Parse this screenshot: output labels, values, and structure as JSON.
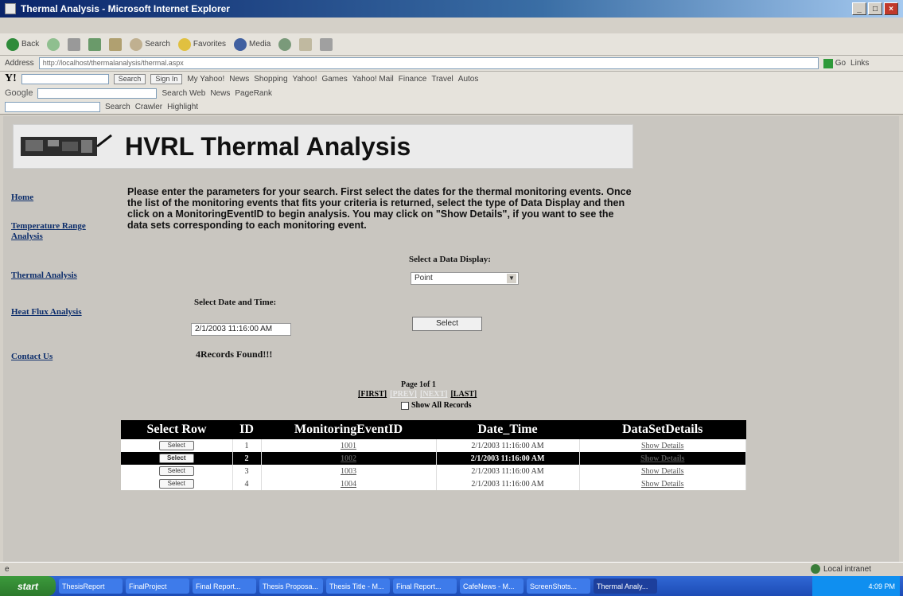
{
  "window": {
    "title": "Thermal Analysis - Microsoft Internet Explorer",
    "controls": [
      "_",
      "□",
      "×"
    ]
  },
  "toolbar": {
    "back": "Back",
    "search": "Search",
    "favorites": "Favorites",
    "media": "Media"
  },
  "address": {
    "label": "Address",
    "url": "http://localhost/thermalanalysis/thermal.aspx",
    "go": "Go",
    "links": "Links"
  },
  "yahoo_bar": {
    "logo": "Y!",
    "search_btn": "Search",
    "signin_btn": "Sign In",
    "items": [
      "My Yahoo!",
      "News",
      "Shopping",
      "Yahoo!",
      "Games",
      "Yahoo! Mail",
      "Finance",
      "Travel",
      "Autos"
    ]
  },
  "google_bar": {
    "logo": "Google",
    "search_web": "Search Web",
    "news": "News",
    "pagerank": "PageRank"
  },
  "search_bar": {
    "search": "Search",
    "crawler": "Crawler",
    "highlight": "Highlight"
  },
  "page": {
    "title": "HVRL Thermal Analysis",
    "nav": [
      {
        "label": "Home"
      },
      {
        "label": "Temperature Range Analysis"
      },
      {
        "label": "Thermal Analysis"
      },
      {
        "label": "Heat Flux Analysis"
      },
      {
        "label": "Contact Us"
      }
    ],
    "instructions": "Please enter the parameters for your search. First select the dates for the thermal monitoring events. Once the list of the monitoring events that fits your criteria is returned, select the type of Data Display and then click on a MonitoringEventID to begin analysis. You may click on \"Show Details\", if you want to see the data sets corresponding to each monitoring event.",
    "data_display_label": "Select a Data Display:",
    "data_display_value": "Point",
    "date_label": "Select Date and Time:",
    "date_value": "2/1/2003 11:16:00 AM",
    "select_button": "Select",
    "records_found": "4Records Found!!!",
    "pager": {
      "info": "Page 1of 1",
      "first": "[FIRST]",
      "prev": "[PREV]",
      "next": "[NEXT]",
      "last": "[LAST]"
    },
    "show_all": "Show All Records"
  },
  "table": {
    "headers": [
      "Select Row",
      "ID",
      "MonitoringEventID",
      "Date_Time",
      "DataSetDetails"
    ],
    "rows": [
      {
        "select": "Select",
        "id": "1",
        "event": "1001",
        "date": "2/1/2003 11:16:00 AM",
        "details": "Show Details"
      },
      {
        "select": "Select",
        "id": "2",
        "event": "1002",
        "date": "2/1/2003 11:16:00 AM",
        "details": "Show Details"
      },
      {
        "select": "Select",
        "id": "3",
        "event": "1003",
        "date": "2/1/2003 11:16:00 AM",
        "details": "Show Details"
      },
      {
        "select": "Select",
        "id": "4",
        "event": "1004",
        "date": "2/1/2003 11:16:00 AM",
        "details": "Show Details"
      }
    ],
    "selected_row": 2
  },
  "status": {
    "left": "e",
    "zone": "Local intranet"
  },
  "taskbar": {
    "start": "start",
    "tasks": [
      "ThesisReport",
      "FinalProject",
      "Final Report...",
      "Thesis Proposa...",
      "Thesis Title - M...",
      "Final Report...",
      "CafeNews - M...",
      "ScreenShots...",
      "Thermal Analy..."
    ],
    "clock": "4:09 PM"
  },
  "colors": {
    "nav_link": "#0c2d6b",
    "table_header_bg": "#000000",
    "selected_row_bg": "#000000",
    "page_bg": "#c9c6c0"
  }
}
